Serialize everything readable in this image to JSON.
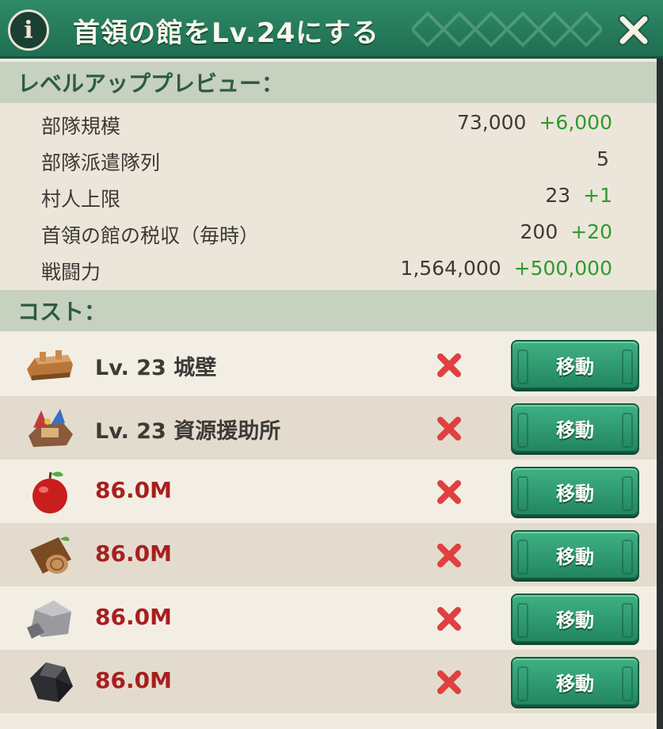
{
  "header": {
    "info_icon": "i",
    "title": "首領の館をLv.24にする"
  },
  "preview": {
    "heading": "レベルアッププレビュー：",
    "stats": [
      {
        "label": "部隊規模",
        "value": "73,000",
        "increase": "+6,000"
      },
      {
        "label": "部隊派遣隊列",
        "value": "5",
        "increase": ""
      },
      {
        "label": "村人上限",
        "value": "23",
        "increase": "+1"
      },
      {
        "label": "首領の館の税収（毎時）",
        "value": "200",
        "increase": "+20"
      },
      {
        "label": "戦闘力",
        "value": "1,564,000",
        "increase": "+500,000"
      }
    ]
  },
  "cost": {
    "heading": "コスト：",
    "items": [
      {
        "icon": "wall-icon",
        "text": "Lv. 23  城壁",
        "kind": "requirement",
        "status": "unmet",
        "button": "移動"
      },
      {
        "icon": "resource-aid-station-icon",
        "text": "Lv. 23  資源援助所",
        "kind": "requirement",
        "status": "unmet",
        "button": "移動"
      },
      {
        "icon": "apple-food-icon",
        "text": "86.0M",
        "kind": "resource",
        "status": "unmet",
        "button": "移動"
      },
      {
        "icon": "wood-log-icon",
        "text": "86.0M",
        "kind": "resource",
        "status": "unmet",
        "button": "移動"
      },
      {
        "icon": "stone-icon",
        "text": "86.0M",
        "kind": "resource",
        "status": "unmet",
        "button": "移動"
      },
      {
        "icon": "iron-ore-icon",
        "text": "86.0M",
        "kind": "resource",
        "status": "unmet",
        "button": "移動"
      }
    ]
  },
  "colors": {
    "header_green": "#2f8a68",
    "increase_green": "#2e9a2e",
    "insufficient_red": "#a81f1f",
    "button_green": "#3fb184",
    "section_bg": "#c7d1bf"
  }
}
